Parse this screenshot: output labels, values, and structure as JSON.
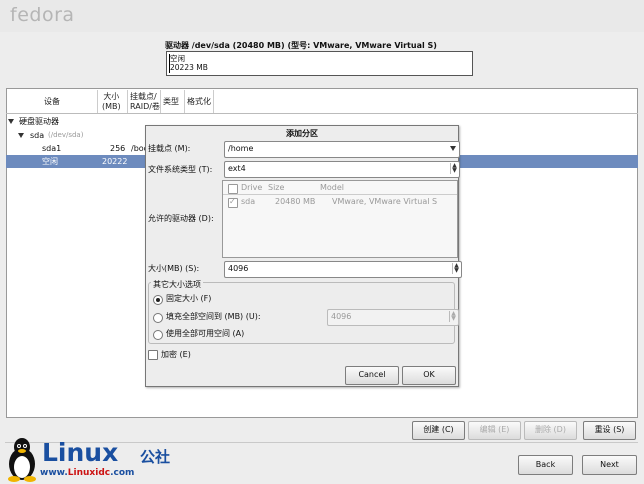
{
  "app": {
    "logo": "fedora"
  },
  "drive": {
    "title": "驱动器 /dev/sda (20480 MB) (型号: VMware, VMware Virtual S)",
    "map_label": "空闲",
    "map_size": "20223 MB"
  },
  "table": {
    "headers": {
      "device": "设备",
      "size": "大小\n(MB)",
      "mount": "挂载点/\nRAID/卷",
      "type": "类型",
      "format": "格式化"
    },
    "rows": {
      "hard_drives": "硬盘驱动器",
      "sda": "sda",
      "sda_path": "(/dev/sda)",
      "sda1": "sda1",
      "sda1_size": "256",
      "sda1_mount": "/boo",
      "free": "空闲",
      "free_size": "20222"
    }
  },
  "dialog": {
    "title": "添加分区",
    "mount_label": "挂载点 (M):",
    "mount_value": "/home",
    "fs_label": "文件系统类型 (T):",
    "fs_value": "ext4",
    "drives_label": "允许的驱动器 (D):",
    "drive_headers": {
      "drive": "Drive",
      "size": "Size",
      "model": "Model"
    },
    "drive_row": {
      "drive": "sda",
      "size": "20480 MB",
      "model": "VMware, VMware Virtual S"
    },
    "size_label": "大小(MB) (S):",
    "size_value": "4096",
    "options_title": "其它大小选项",
    "opt_fixed": "固定大小 (F)",
    "opt_fill_to": "填充全部空间到 (MB) (U):",
    "opt_fill_value": "4096",
    "opt_fill_all": "使用全部可用空间 (A)",
    "encrypt": "加密 (E)",
    "cancel": "Cancel",
    "ok": "OK"
  },
  "actions": {
    "create": "创建 (C)",
    "edit": "编辑 (E)",
    "delete": "删除 (D)",
    "reset": "重设 (S)"
  },
  "nav": {
    "back": "Back",
    "next": "Next"
  },
  "watermark": {
    "brand": "Linux",
    "cn": "公社",
    "url_prefix": "www.",
    "url_main": "Linuxidc",
    "url_suffix": ".com"
  },
  "colors": {
    "selection": "#6d8bbe",
    "watermark": "#1a4fa0"
  }
}
